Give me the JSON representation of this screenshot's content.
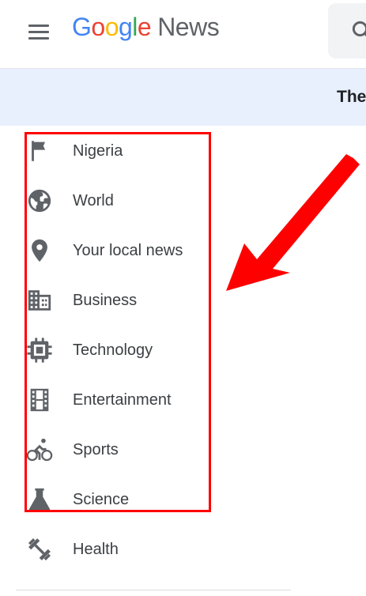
{
  "header": {
    "logo": {
      "google_letters": [
        {
          "char": "G",
          "color": "#4285F4"
        },
        {
          "char": "o",
          "color": "#EA4335"
        },
        {
          "char": "o",
          "color": "#FBBC05"
        },
        {
          "char": "g",
          "color": "#4285F4"
        },
        {
          "char": "l",
          "color": "#34A853"
        },
        {
          "char": "e",
          "color": "#EA4335"
        }
      ],
      "product": "News"
    },
    "menu_icon": "hamburger-menu-icon",
    "search_icon": "search-icon"
  },
  "banner": {
    "text": "The"
  },
  "sidebar": {
    "items": [
      {
        "label": "Nigeria",
        "icon": "flag-icon"
      },
      {
        "label": "World",
        "icon": "globe-icon"
      },
      {
        "label": "Your local news",
        "icon": "location-pin-icon"
      },
      {
        "label": "Business",
        "icon": "building-icon"
      },
      {
        "label": "Technology",
        "icon": "chip-icon"
      },
      {
        "label": "Entertainment",
        "icon": "film-icon"
      },
      {
        "label": "Sports",
        "icon": "bike-icon"
      },
      {
        "label": "Science",
        "icon": "flask-icon"
      },
      {
        "label": "Health",
        "icon": "dumbbell-icon"
      }
    ]
  },
  "colors": {
    "icon_gray": "#5f6368",
    "text_dark": "#3c4043",
    "banner_bg": "#e8f0fe",
    "annotation_red": "#ff0000"
  }
}
